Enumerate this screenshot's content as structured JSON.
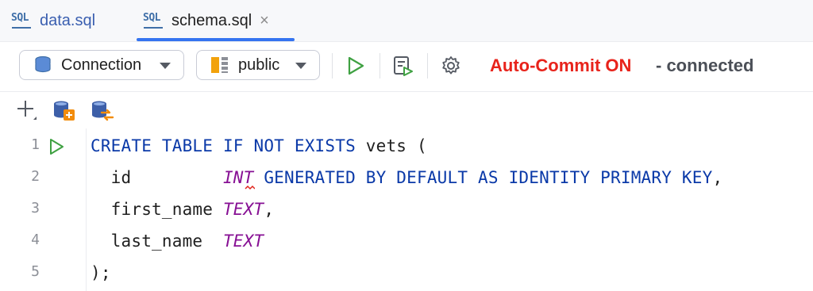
{
  "tabs": [
    {
      "icon": "sql-file-icon",
      "icon_text": "SQL",
      "label": "data.sql",
      "active": false
    },
    {
      "icon": "sql-file-icon",
      "icon_text": "SQL",
      "label": "schema.sql",
      "active": true,
      "close_glyph": "×"
    }
  ],
  "toolbar": {
    "connection_label": "Connection",
    "schema_label": "public",
    "status_mode": "Auto-Commit ON",
    "status_connection": "- connected",
    "colors": {
      "status_on": "#e8231b",
      "accent": "#3574f0",
      "run": "#3fa142"
    },
    "buttons": [
      "run-icon",
      "explain-plan-icon",
      "gear-icon"
    ]
  },
  "subtoolbar": {
    "buttons": [
      "add-icon",
      "add-datasource-icon",
      "migrate-datasource-icon"
    ]
  },
  "editor": {
    "lines": [
      {
        "num": "1",
        "tokens": [
          "CREATE TABLE IF NOT EXISTS",
          " vets ("
        ]
      },
      {
        "num": "2",
        "tokens": [
          "  id         ",
          "INT",
          " GENERATED BY DEFAULT AS IDENTITY PRIMARY KEY",
          ","
        ]
      },
      {
        "num": "3",
        "tokens": [
          "  first_name ",
          "TEXT",
          ","
        ]
      },
      {
        "num": "4",
        "tokens": [
          "  last_name  ",
          "TEXT"
        ]
      },
      {
        "num": "5",
        "tokens": [
          ");"
        ]
      }
    ]
  }
}
